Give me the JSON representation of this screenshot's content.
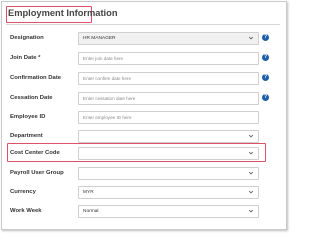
{
  "section": {
    "title": "Employment Information"
  },
  "fields": [
    {
      "label": "Designation",
      "kind": "select",
      "value": "HR MANAGER",
      "placeholder": "",
      "help": true
    },
    {
      "label": "Join Date *",
      "kind": "text",
      "value": "",
      "placeholder": "Enter join date here",
      "help": true
    },
    {
      "label": "Confirmation Date",
      "kind": "text",
      "value": "",
      "placeholder": "Enter confirm date here",
      "help": true
    },
    {
      "label": "Cessation Date",
      "kind": "text",
      "value": "",
      "placeholder": "Enter cessation date here",
      "help": true
    },
    {
      "label": "Employee ID",
      "kind": "text",
      "value": "",
      "placeholder": "Enter employee ID here",
      "help": false
    },
    {
      "label": "Department",
      "kind": "select",
      "value": "",
      "placeholder": "",
      "help": false
    },
    {
      "label": "Cost Center Code",
      "kind": "select",
      "value": "",
      "placeholder": "",
      "help": false
    },
    {
      "label": "Payroll User Group",
      "kind": "select",
      "value": "",
      "placeholder": "",
      "help": false
    },
    {
      "label": "Currency",
      "kind": "select",
      "value": "MYR",
      "placeholder": "",
      "help": false
    },
    {
      "label": "Work Week",
      "kind": "select",
      "value": "Normal",
      "placeholder": "",
      "help": false
    }
  ],
  "help_glyph": "?",
  "colors": {
    "highlight": "#e0506a",
    "help_icon": "#1d5fa8"
  }
}
